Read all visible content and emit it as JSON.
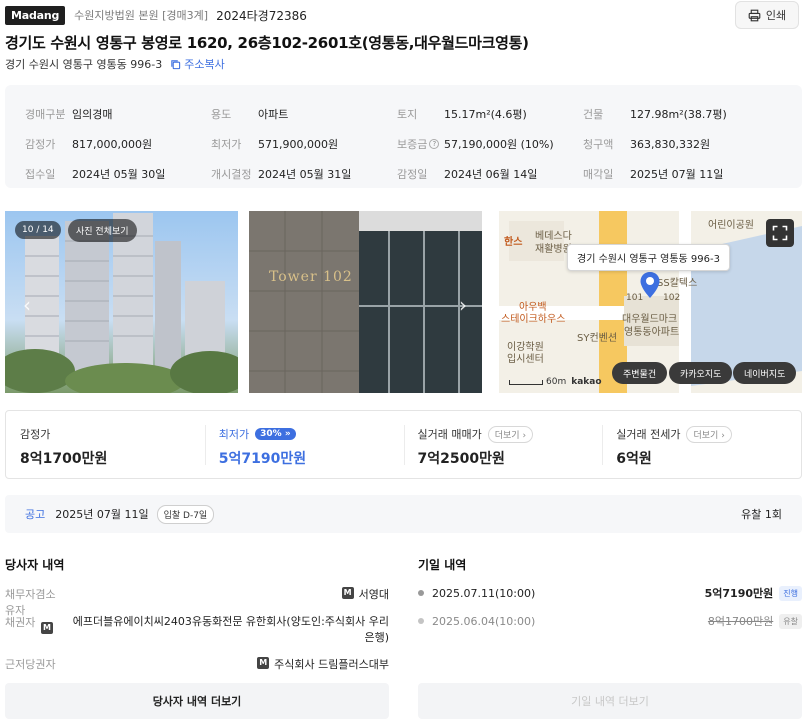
{
  "header": {
    "brand": "Madang",
    "court": "수원지방법원 본원 [경매3계]",
    "case_no": "2024타경72386",
    "print_label": "인쇄"
  },
  "property": {
    "title": "경기도 수원시 영통구 봉영로 1620, 26층102-2601호(영통동,대우월드마크영통)",
    "lot_address": "경기 수원시 영통구 영통동 996-3",
    "copy_label": "주소복사"
  },
  "info": [
    [
      {
        "k": "경매구분",
        "v": "임의경매"
      },
      {
        "k": "용도",
        "v": "아파트"
      },
      {
        "k": "토지",
        "v": "15.17m²(4.6평)"
      },
      {
        "k": "건물",
        "v": "127.98m²(38.7평)"
      }
    ],
    [
      {
        "k": "감정가",
        "v": "817,000,000원"
      },
      {
        "k": "최저가",
        "v": "571,900,000원"
      },
      {
        "k": "보증금",
        "v": "57,190,000원 (10%)"
      },
      {
        "k": "청구액",
        "v": "363,830,332원"
      }
    ],
    [
      {
        "k": "접수일",
        "v": "2024년 05월 30일"
      },
      {
        "k": "개시결정",
        "v": "2024년 05월 31일"
      },
      {
        "k": "감정일",
        "v": "2024년 06월 14일"
      },
      {
        "k": "매각일",
        "v": "2025년 07월 11일"
      }
    ]
  ],
  "photos": {
    "count": "10 / 14",
    "view_all": "사진 전체보기",
    "sign_text": "Tower 102"
  },
  "map": {
    "tooltip": "경기 수원시 영통구 영통동 996-3",
    "labels": [
      "베데스다",
      "재활병원",
      "어린이공원",
      "한스",
      "SS칼텍스",
      "아우백",
      "스테이크하우스",
      "대우월드마크",
      "영통동아파트",
      "SY컨벤션",
      "이강학원",
      "입시센터",
      "101",
      "102"
    ],
    "scale": "60m",
    "provider": "kakao",
    "buttons": [
      "주변물건",
      "카카오지도",
      "네이버지도"
    ]
  },
  "prices": {
    "appraisal_label": "감정가",
    "appraisal_value": "8억1700만원",
    "min_label": "최저가",
    "min_pct": "30%",
    "min_value": "5억7190만원",
    "trade_label": "실거래 매매가",
    "trade_more": "더보기",
    "trade_value": "7억2500만원",
    "jeonse_label": "실거래 전세가",
    "jeonse_more": "더보기",
    "jeonse_value": "6억원"
  },
  "notice": {
    "label": "공고",
    "date": "2025년 07월 11일",
    "dday": "입찰 D-7일",
    "fail_count": "유찰 1회"
  },
  "parties": {
    "title": "당사자 내역",
    "rows": [
      {
        "k": "채무자겸소유자",
        "badge": "M",
        "v": "서영대"
      },
      {
        "k": "채권자",
        "badge": "M",
        "v": "에프더블유에이치씨2403유동화전문 유한회사(양도인:주식회사 우리은행)"
      },
      {
        "k": "근저당권자",
        "badge": "M",
        "v": "주식회사 드림플러스대부"
      }
    ],
    "more_button": "당사자 내역 더보기"
  },
  "history": {
    "title": "기일 내역",
    "rows": [
      {
        "date": "2025.07.11(10:00)",
        "amount": "5억7190만원",
        "status": "진행"
      },
      {
        "date": "2025.06.04(10:00)",
        "amount": "8억1700만원",
        "status": "유찰"
      }
    ],
    "more_button": "기일 내역 더보기"
  },
  "colors": {
    "accent": "#3d6fe0",
    "panel_bg": "#f6f7f9"
  }
}
